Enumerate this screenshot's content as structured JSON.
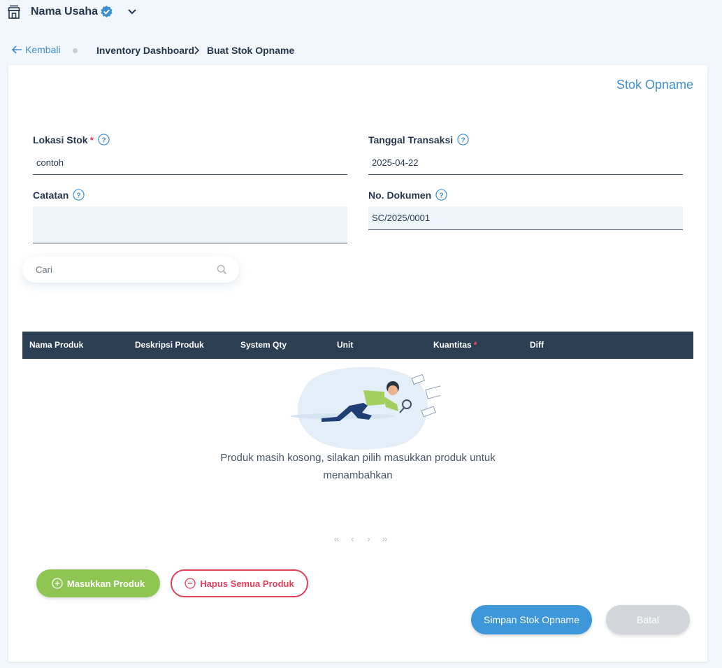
{
  "header": {
    "business_name": "Nama Usaha",
    "store_icon": "store-icon",
    "verified_icon": "verified-badge-icon",
    "dropdown_icon": "chevron-down-icon"
  },
  "breadcrumb": {
    "back_label": "Kembali",
    "items": [
      "Inventory Dashboard",
      "Buat Stok Opname"
    ]
  },
  "page": {
    "title": "Stok Opname"
  },
  "form": {
    "lokasi_stok": {
      "label": "Lokasi Stok",
      "required_mark": "*",
      "value": "contoh"
    },
    "tanggal_transaksi": {
      "label": "Tanggal Transaksi",
      "value": "2025-04-22"
    },
    "catatan": {
      "label": "Catatan",
      "value": ""
    },
    "no_dokumen": {
      "label": "No. Dokumen",
      "value": "SC/2025/0001"
    }
  },
  "search": {
    "placeholder": "Cari"
  },
  "table": {
    "columns": [
      "Nama Produk",
      "Deskripsi Produk",
      "System Qty",
      "Unit",
      "Kuantitas",
      "Diff"
    ],
    "required_mark": "*",
    "rows": [],
    "empty_message": "Produk masih kosong, silakan pilih masukkan produk untuk menambahkan"
  },
  "pagination": {
    "first": "«",
    "prev": "‹",
    "next": "›",
    "last": "»"
  },
  "actions": {
    "add_products": "Masukkan Produk",
    "remove_all": "Hapus Semua Produk",
    "save": "Simpan Stok Opname",
    "cancel": "Batal"
  },
  "colors": {
    "accent": "#3d97d8",
    "table_header": "#2c3e52",
    "add_button": "#8fc552",
    "danger": "#e0405a",
    "disabled": "#d2d6da",
    "page_background": "#f1f7fc"
  }
}
